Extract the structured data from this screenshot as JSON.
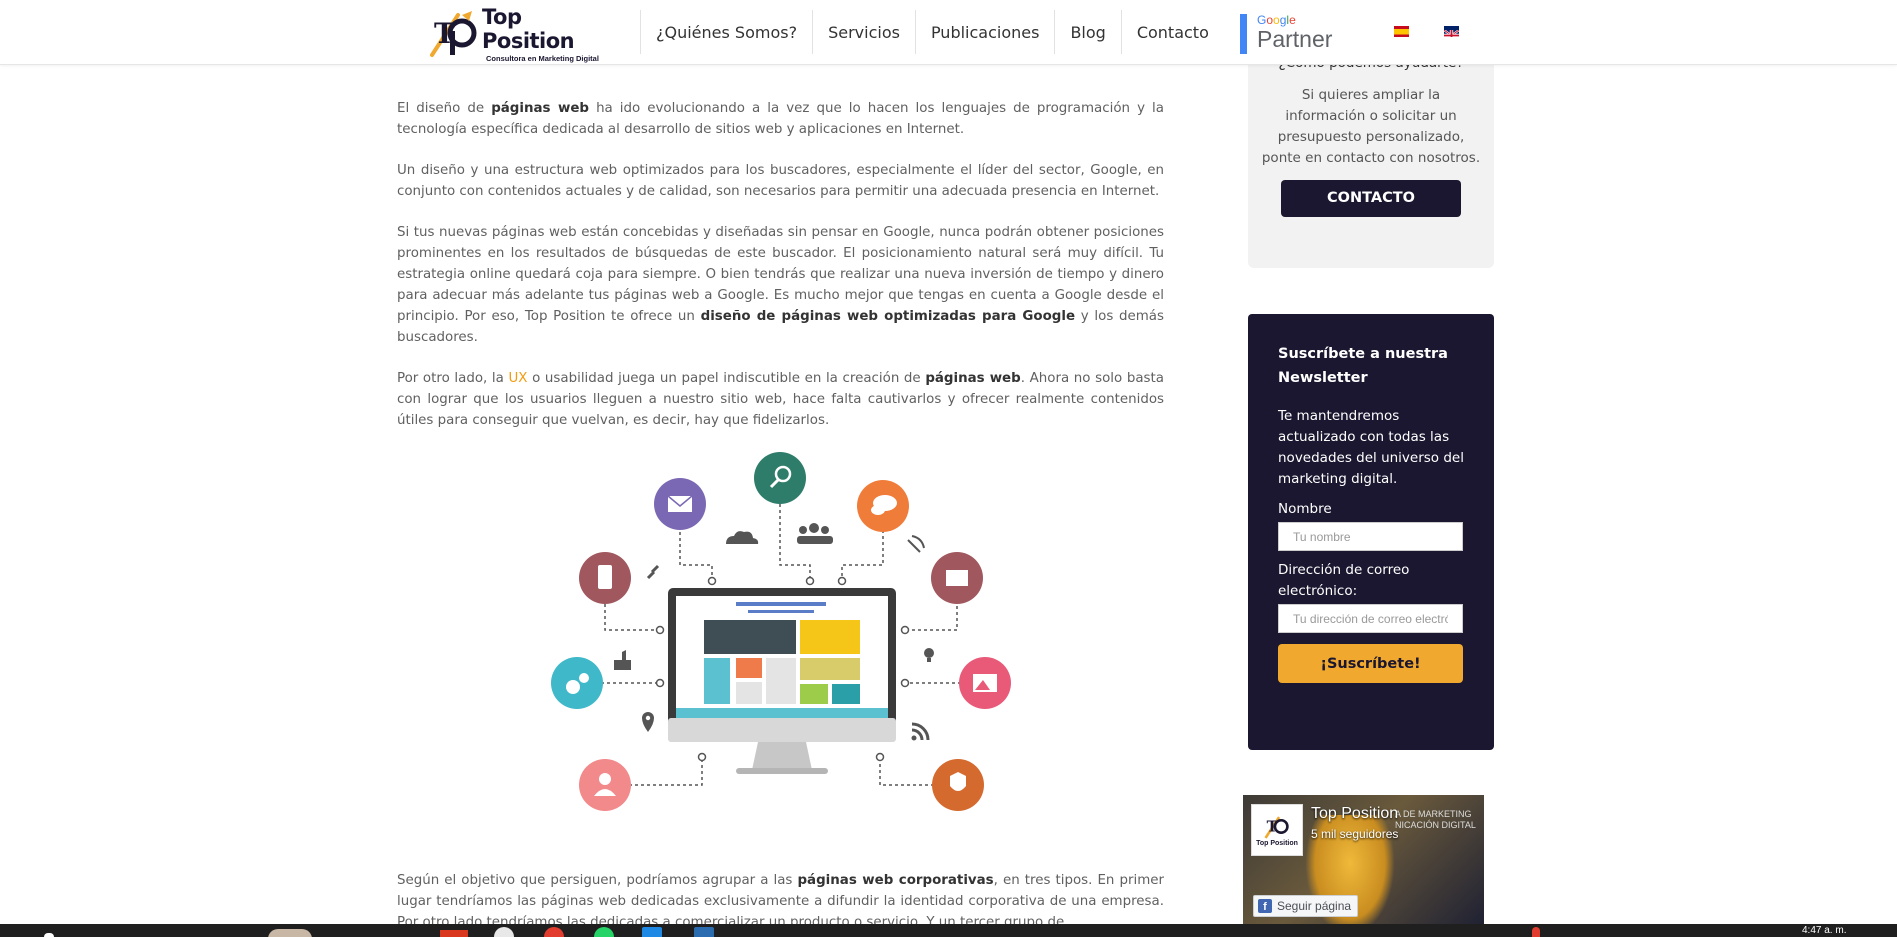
{
  "header": {
    "logo_name": "Top Position",
    "logo_tagline": "Consultora en Marketing Digital",
    "nav": [
      "¿Quiénes Somos?",
      "Servicios",
      "Publicaciones",
      "Blog",
      "Contacto"
    ],
    "partner_google": "Google",
    "partner_label": "Partner",
    "languages": [
      "es-flag",
      "en-flag"
    ]
  },
  "article": {
    "p1": {
      "a": "El diseño de ",
      "b": "páginas web",
      "c": " ha ido evolucionando a la vez que lo hacen los lenguajes de programación y la tecnología específica dedicada al desarrollo de sitios web y aplicaciones en Internet."
    },
    "p2": "Un diseño y una estructura web optimizados para los buscadores, especialmente el líder del sector, Google, en conjunto con contenidos actuales y de calidad, son necesarios para permitir una adecuada presencia en Internet.",
    "p3": {
      "a": "Si tus nuevas páginas web están concebidas y diseñadas sin pensar en Google, nunca podrán obtener posiciones prominentes en los resultados de búsquedas de este buscador. El posicionamiento natural será muy difícil. Tu estrategia online quedará coja para siempre. O bien tendrás que realizar una nueva inversión de tiempo y dinero para adecuar más adelante tus páginas web a Google. Es mucho mejor que tengas en cuenta a Google desde el principio. Por eso, Top Position te ofrece un ",
      "b": "diseño de páginas web optimizadas para Google",
      "c": " y los demás buscadores."
    },
    "p4": {
      "a": "Por otro lado, la ",
      "ux": "UX",
      "b": " o usabilidad juega un papel indiscutible en la creación de ",
      "c": "páginas web",
      "d": ".  Ahora no solo basta con lograr que los usuarios lleguen a nuestro sitio web, hace falta cautivarlos y ofrecer realmente contenidos útiles para conseguir que vuelvan, es decir, hay que fidelizarlos."
    },
    "p5": {
      "a": "Según el objetivo que persiguen, podríamos agrupar a las ",
      "b": "páginas web corporativas",
      "c": ", en tres tipos.  En primer lugar tendríamos las páginas web dedicadas exclusivamente a difundir la identidad corporativa de una empresa.  Por otro lado tendríamos las dedicadas a comercializar un producto o servicio.  Y un tercer grupo de"
    }
  },
  "sidebar": {
    "help_title": "¿Cómo podemos ayudarte?",
    "help_text": "Si quieres ampliar la información o solicitar un presupuesto personalizado, ponte en contacto con nosotros.",
    "contact_button": "CONTACTO",
    "newsletter": {
      "title": "Suscríbete a nuestra Newsletter",
      "text": "Te mantendremos actualizado con todas las novedades del universo del marketing digital.",
      "name_label": "Nombre",
      "name_placeholder": "Tu nombre",
      "email_label": "Dirección de correo electrónico:",
      "email_placeholder": "Tu dirección de correo electrónico",
      "submit": "¡Suscríbete!"
    },
    "facebook": {
      "page_name": "Top Position",
      "followers": "5 mil seguidores",
      "follow_button": "Seguir página",
      "bg_text_1": "A DE MARKETING",
      "bg_text_2": "NICACIÓN DIGITAL"
    }
  },
  "taskbar": {
    "clock": "4:47 a. m."
  },
  "colors": {
    "brand_dark": "#1b1730",
    "accent_orange": "#f0a92e",
    "ux_link": "#f39c12",
    "google_blue": "#4285f4"
  }
}
